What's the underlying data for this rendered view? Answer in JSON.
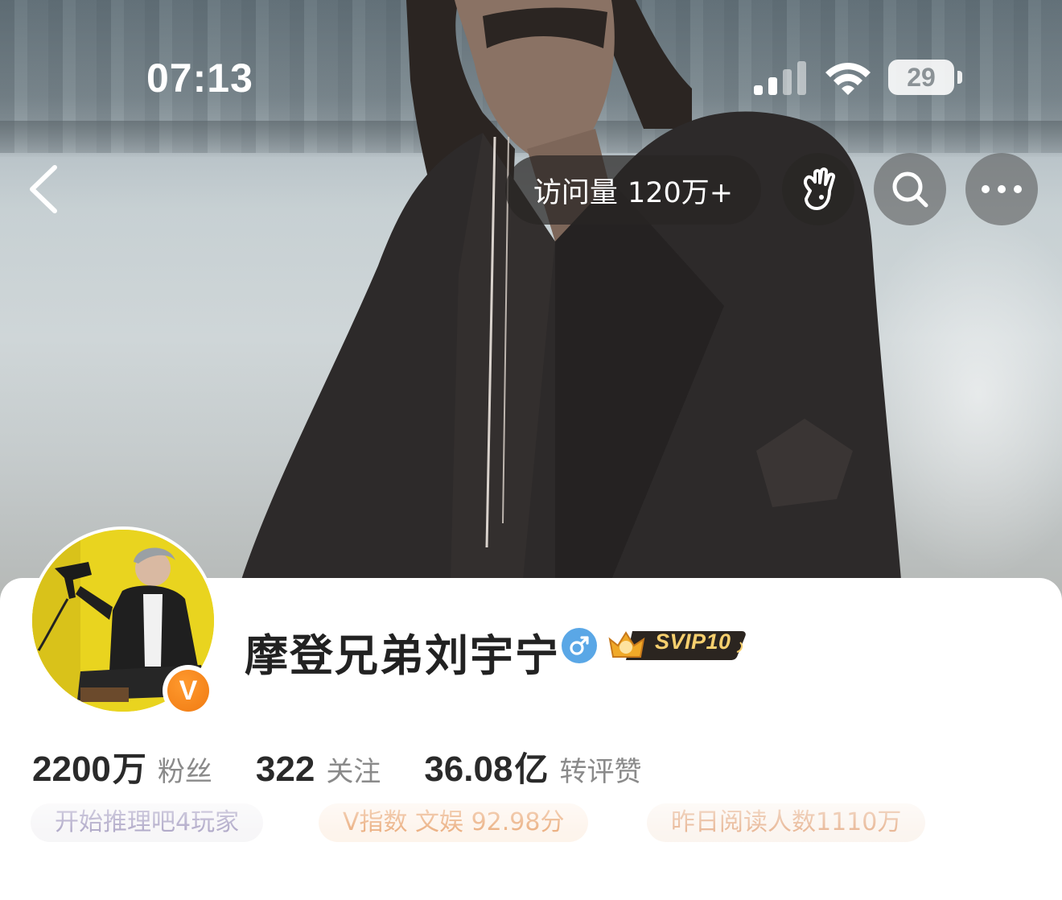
{
  "status_bar": {
    "time": "07:13",
    "battery": "29",
    "icons": [
      "signal-icon",
      "wifi-icon",
      "battery-icon"
    ]
  },
  "nav": {
    "visits_label": "访问量",
    "visits_count": "120万+",
    "icons": [
      "back-icon",
      "hand-wave-icon",
      "search-icon",
      "more-icon"
    ]
  },
  "profile": {
    "name": "摩登兄弟刘宇宁",
    "gender_icon": "male-icon",
    "vip_badge": "SVIP10",
    "verified_icon": "verified-v-icon"
  },
  "stats": [
    {
      "number": "2200",
      "unit": "万",
      "label": "粉丝"
    },
    {
      "number": "322",
      "unit": "",
      "label": "关注"
    },
    {
      "number": "36.08",
      "unit": "亿",
      "label": "转评赞"
    }
  ],
  "tags": [
    {
      "text": "开始推理吧4玩家"
    },
    {
      "text": "V指数 文娱 92.98分"
    },
    {
      "text": "昨日阅读人数1110万"
    }
  ],
  "colors": {
    "gender_blue": "#5aa7e6",
    "verified_orange": "#f07a12",
    "svip_gold": "#f6cf6e"
  }
}
